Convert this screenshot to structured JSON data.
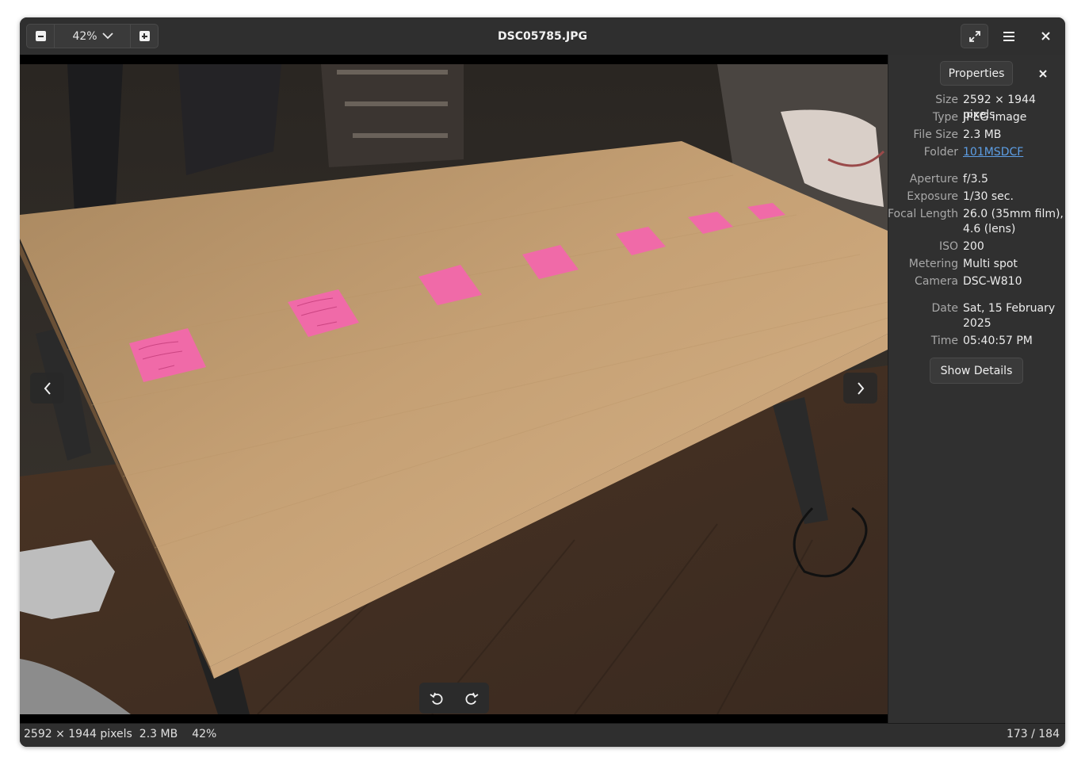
{
  "window": {
    "title": "DSC05785.JPG"
  },
  "zoom": {
    "value": "42%",
    "minus_icon": "minus-icon",
    "plus_icon": "plus-icon",
    "dropdown_icon": "chevron-down-icon"
  },
  "header": {
    "fullscreen_icon": "fullscreen-icon",
    "menu_icon": "hamburger-menu-icon",
    "close_icon": "close-icon"
  },
  "viewer": {
    "image_alt": "Photo of a wooden table with pink sticky notes",
    "prev_icon": "chevron-left-icon",
    "next_icon": "chevron-right-icon",
    "rotate_left_icon": "rotate-left-icon",
    "rotate_right_icon": "rotate-right-icon"
  },
  "sidebar": {
    "title_button": "Properties",
    "close_icon": "close-icon",
    "properties": [
      {
        "label": "Size",
        "value": "2592 × 1944 pixels"
      },
      {
        "label": "Type",
        "value": "JPEG image"
      },
      {
        "label": "File Size",
        "value": "2.3 MB"
      },
      {
        "label": "Folder",
        "value": "101MSDCF",
        "link": true
      },
      {
        "label": "Aperture",
        "value": "f/3.5"
      },
      {
        "label": "Exposure",
        "value": "1/30 sec."
      },
      {
        "label": "Focal Length",
        "value": "26.0 (35mm film), 4.6 (lens)"
      },
      {
        "label": "ISO",
        "value": "200"
      },
      {
        "label": "Metering",
        "value": "Multi spot"
      },
      {
        "label": "Camera",
        "value": "DSC-W810"
      },
      {
        "label": "Date",
        "value": "Sat, 15 February 2025"
      },
      {
        "label": "Time",
        "value": "05:40:57 PM"
      }
    ],
    "details_button": "Show Details"
  },
  "status": {
    "dimensions": "2592 × 1944 pixels",
    "file_size": "2.3 MB",
    "zoom": "42%",
    "position": "173 / 184"
  },
  "colors": {
    "link": "#5d9ee5",
    "sticky_note": "#f06aa8",
    "table": "#c9a070"
  }
}
